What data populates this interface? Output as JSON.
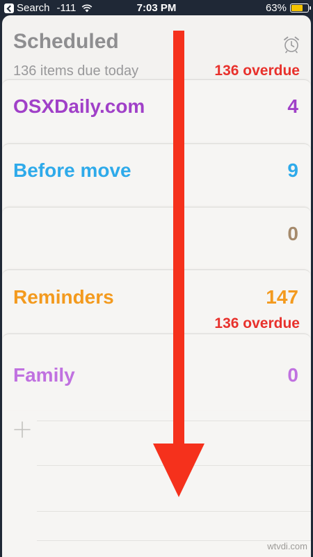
{
  "status_bar": {
    "back_label": "Search",
    "signal": "-111",
    "wifi_icon": "wifi-icon",
    "time": "7:03 PM",
    "battery_percent": "63%",
    "battery_level": 0.63,
    "battery_color": "#f5c400"
  },
  "header": {
    "title": "Scheduled",
    "subtitle": "136 items due today",
    "overdue": "136 overdue",
    "icon": "alarm-clock-icon"
  },
  "lists": [
    {
      "label": "OSXDaily.com",
      "count": "4",
      "color": "#a040c8",
      "overdue": ""
    },
    {
      "label": "Before move",
      "count": "9",
      "color": "#2eaaea",
      "overdue": ""
    },
    {
      "label": "",
      "count": "0",
      "color": "#a58a6c",
      "overdue": ""
    },
    {
      "label": "Reminders",
      "count": "147",
      "color": "#f39a1e",
      "overdue": "136 overdue"
    },
    {
      "label": "Family",
      "count": "0",
      "color": "#c071e0",
      "overdue": ""
    }
  ],
  "add_icon": "plus-icon",
  "overlay": {
    "icon": "down-arrow-icon",
    "color": "#f5311c"
  },
  "watermark": "wtvdi.com"
}
